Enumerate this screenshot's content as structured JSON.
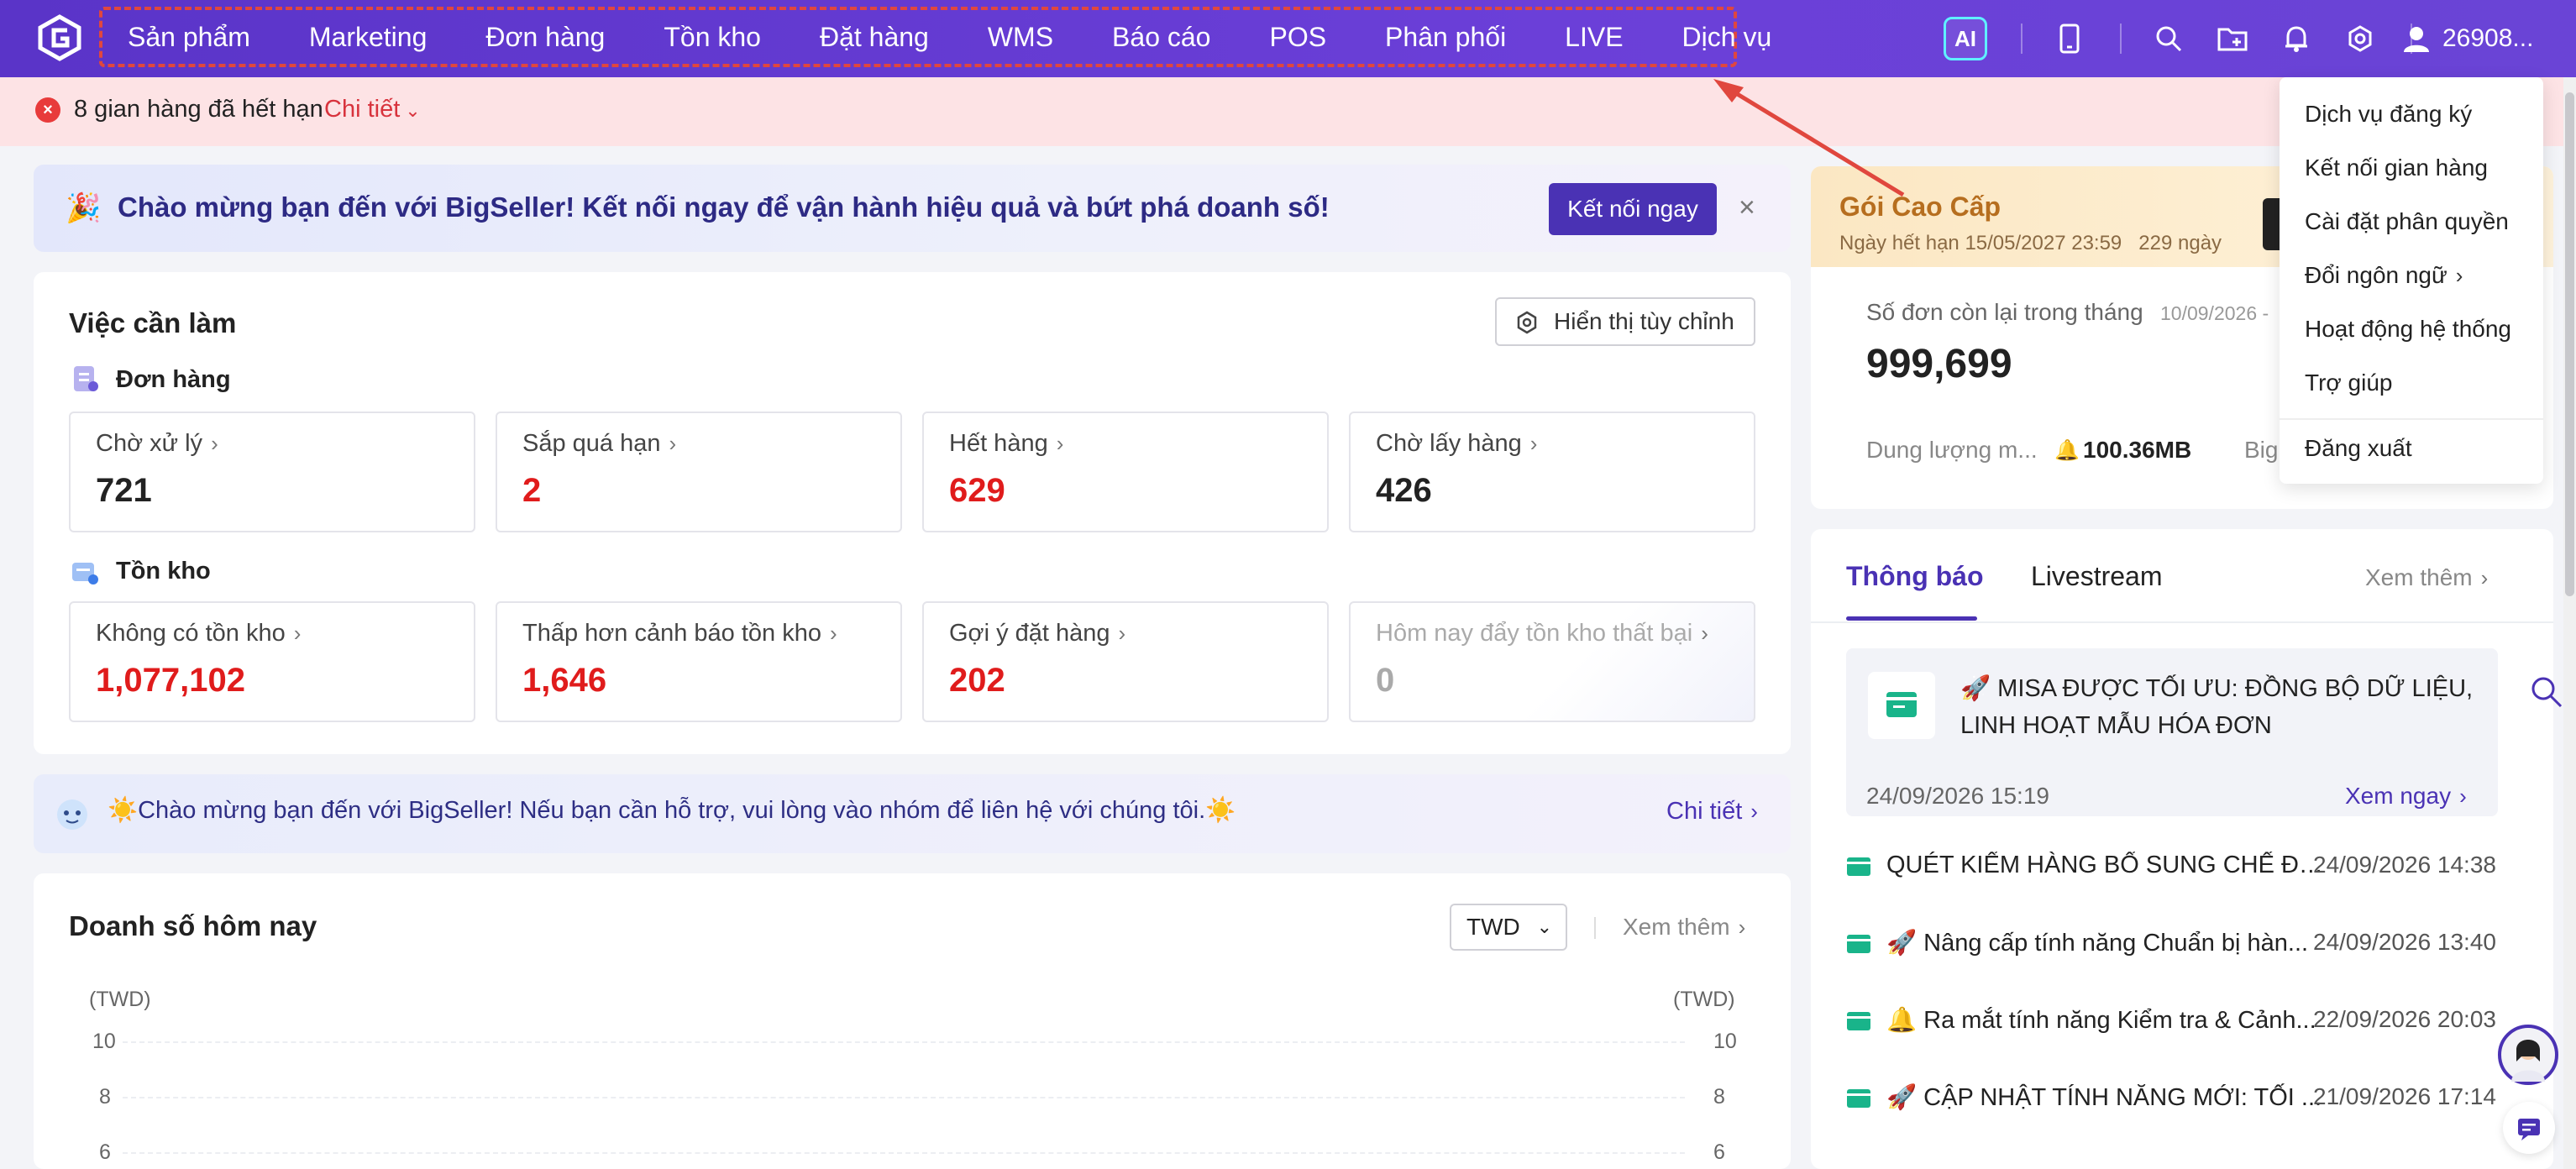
{
  "nav": {
    "items": [
      "Sản phẩm",
      "Marketing",
      "Đơn hàng",
      "Tồn kho",
      "Đặt hàng",
      "WMS",
      "Báo cáo",
      "POS",
      "Phân phối",
      "LIVE",
      "Dịch vụ"
    ]
  },
  "topbar": {
    "ai_label": "AI",
    "icons": [
      "mobile-icon",
      "search-icon",
      "folder-icon",
      "bell-icon",
      "gear-icon"
    ],
    "user_id": "26908..."
  },
  "alert": {
    "text": "8 gian hàng đã hết hạn",
    "link": "Chi tiết"
  },
  "welcome": {
    "emoji": "🎉",
    "text": "Chào mừng bạn đến với BigSeller! Kết nối ngay để vận hành hiệu quả và bứt phá doanh số!",
    "button": "Kết nối ngay",
    "close": "×"
  },
  "todo": {
    "title": "Việc cần làm",
    "custom_button": "Hiển thị tùy chỉnh",
    "orders_section": "Đơn hàng",
    "orders": [
      {
        "label": "Chờ xử lý",
        "value": "721",
        "red": false
      },
      {
        "label": "Sắp quá hạn",
        "value": "2",
        "red": true
      },
      {
        "label": "Hết hàng",
        "value": "629",
        "red": true
      },
      {
        "label": "Chờ lấy hàng",
        "value": "426",
        "red": false
      }
    ],
    "stock_section": "Tồn kho",
    "stock": [
      {
        "label": "Không có tồn kho",
        "value": "1,077,102",
        "red": true
      },
      {
        "label": "Thấp hơn cảnh báo tồn kho",
        "value": "1,646",
        "red": true
      },
      {
        "label": "Gợi ý đặt hàng",
        "value": "202",
        "red": true
      },
      {
        "label": "Hôm nay đẩy tồn kho thất bại",
        "value": "0",
        "red": false
      }
    ]
  },
  "support": {
    "text": "☀️Chào mừng bạn đến với BigSeller! Nếu bạn cần hỗ trợ, vui lòng vào nhóm để liên hệ với chúng tôi.☀️",
    "link": "Chi tiết"
  },
  "sales": {
    "title": "Doanh số hôm nay",
    "currency": "TWD",
    "more": "Xem thêm",
    "axis_unit_left": "(TWD)",
    "axis_unit_right": "(TWD)",
    "ticks": [
      "10",
      "8",
      "6"
    ]
  },
  "plan": {
    "title": "Gói Cao Cấp",
    "expiry": "Ngày hết hạn 15/05/2027 23:59",
    "days_left": "229 ngày",
    "orders_left_label": "Số đơn còn lại trong tháng",
    "orders_left_date": "10/09/2026 -",
    "orders_left_value": "999,699",
    "storage_label": "Dung lượng m...",
    "storage_value": "100.36MB",
    "storage_extra": "Big"
  },
  "notice": {
    "tabs": [
      "Thông báo",
      "Livestream"
    ],
    "more": "Xem thêm",
    "feature": {
      "title": "🚀 MISA ĐƯỢC TỐI ƯU: ĐỒNG BỘ DỮ LIỆU, LINH HOẠT MẪU HÓA ĐƠN",
      "date": "24/09/2026 15:19",
      "link": "Xem ngay"
    },
    "items": [
      {
        "title": "QUÉT KIỂM HÀNG BỔ SUNG CHẾ ĐỘ ...",
        "time": "24/09/2026 14:38"
      },
      {
        "title": "🚀 Nâng cấp tính năng Chuẩn bị hàn...",
        "time": "24/09/2026 13:40"
      },
      {
        "title": "🔔 Ra mắt tính năng Kiểm tra & Cảnh...",
        "time": "22/09/2026 20:03"
      },
      {
        "title": "🚀 CẬP NHẬT TÍNH NĂNG MỚI: TỐI ...",
        "time": "21/09/2026 17:14"
      }
    ]
  },
  "dropdown": {
    "items": [
      "Dịch vụ đăng ký",
      "Kết nối gian hàng",
      "Cài đặt phân quyền",
      "Đổi ngôn ngữ",
      "Hoạt động hệ thống",
      "Trợ giúp",
      "Đăng xuất"
    ]
  },
  "colors": {
    "brand": "#5a34c8",
    "accent": "#4a32b4",
    "danger": "#e01c1c",
    "annotation": "#e0473e"
  }
}
